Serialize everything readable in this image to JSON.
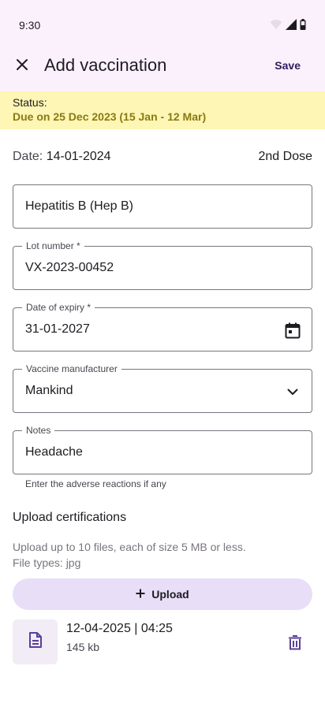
{
  "status_bar": {
    "time": "9:30"
  },
  "app_bar": {
    "title": "Add vaccination",
    "save_label": "Save"
  },
  "status_banner": {
    "label": "Status:",
    "value": "Due on 25 Dec 2023 (15 Jan - 12 Mar)"
  },
  "date_row": {
    "label": "Date:",
    "value": "14-01-2024",
    "dose": "2nd Dose"
  },
  "fields": {
    "vaccine": {
      "value": "Hepatitis B (Hep B)"
    },
    "lot_number": {
      "label": "Lot number *",
      "value": "VX-2023-00452"
    },
    "expiry": {
      "label": "Date of expiry *",
      "value": "31-01-2027"
    },
    "manufacturer": {
      "label": "Vaccine manufacturer",
      "value": "Mankind"
    },
    "notes": {
      "label": "Notes",
      "value": "Headache",
      "helper": "Enter the adverse reactions if any"
    }
  },
  "upload": {
    "section_title": "Upload certifications",
    "info_line1": "Upload up to 10 files, each of size 5 MB or less.",
    "info_line2": "File types: jpg",
    "button_label": "Upload"
  },
  "files": [
    {
      "name": "12-04-2025 | 04:25",
      "size": "145 kb"
    }
  ],
  "colors": {
    "header_bg": "#fbf1fd",
    "banner_bg": "#fdf6b5",
    "banner_text": "#8a7a12",
    "accent": "#5a3f9a",
    "upload_button_bg": "#e8def8"
  },
  "icons": [
    "wifi-icon",
    "signal-icon",
    "battery-icon",
    "close-icon",
    "calendar-icon",
    "chevron-down-icon",
    "plus-icon",
    "file-icon",
    "delete-icon"
  ]
}
